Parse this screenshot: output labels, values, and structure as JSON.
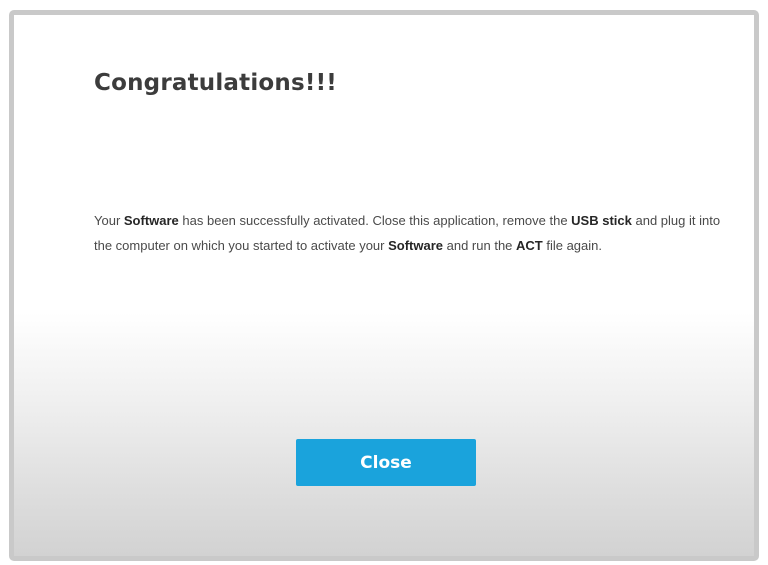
{
  "dialog": {
    "title": "Congratulations!!!",
    "message": {
      "p1": "Your ",
      "b1": "Software",
      "p2": " has been successfully activated.  Close this application, remove the ",
      "b2": "USB stick",
      "p3": " and plug it into the computer on which you started to activate your ",
      "b3": "Software",
      "p4": " and run the ",
      "b4": "ACT",
      "p5": " file again."
    },
    "close_label": "Close"
  },
  "colors": {
    "button_bg": "#1aa3dc",
    "button_text": "#ffffff",
    "title_text": "#3c3c3c",
    "border": "#c9c9c9"
  }
}
